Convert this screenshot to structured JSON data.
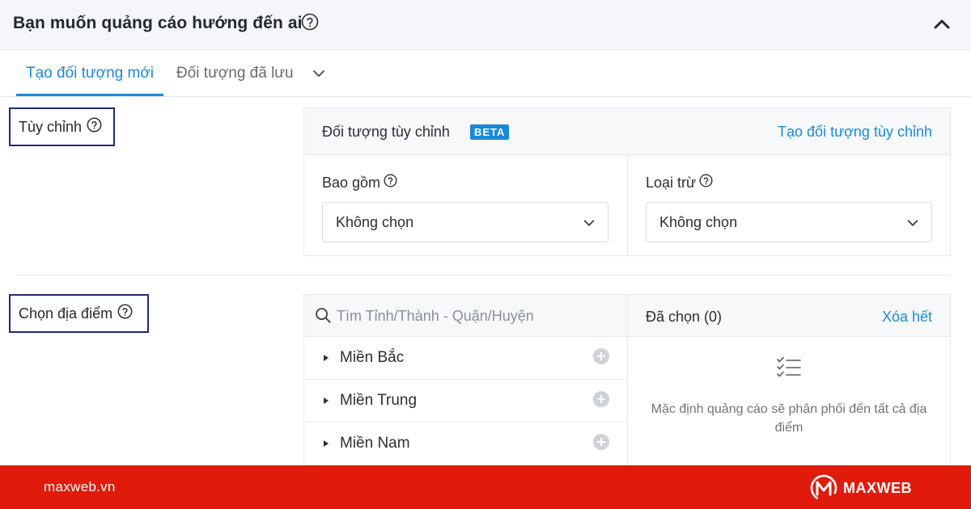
{
  "header": {
    "title": "Bạn muốn quảng cáo hướng đến ai",
    "help_icon": "question-circle-icon",
    "collapse_icon": "chevron-up-icon"
  },
  "tabs": [
    {
      "label": "Tạo đối tượng mới",
      "active": true
    },
    {
      "label": "Đối tượng đã lưu",
      "active": false
    }
  ],
  "custom_section": {
    "label": "Tùy chỉnh",
    "panel_title": "Đối tượng tùy chỉnh",
    "badge": "BETA",
    "create_link": "Tạo đối tượng tùy chỉnh",
    "include": {
      "label": "Bao gồm",
      "value": "Không chọn"
    },
    "exclude": {
      "label": "Loại trừ",
      "value": "Không chọn"
    }
  },
  "location_section": {
    "label": "Chọn địa điểm",
    "search_placeholder": "Tìm Tỉnh/Thành - Quận/Huyện",
    "regions": [
      {
        "name": "Miền Bắc"
      },
      {
        "name": "Miền Trung"
      },
      {
        "name": "Miền Nam"
      }
    ],
    "selected_title": "Đã chọn (0)",
    "clear_link": "Xóa hết",
    "empty_message": "Mặc định quảng cáo sẽ phân phối đến tất cả địa điểm"
  },
  "footer": {
    "site": "maxweb.vn",
    "brand": "MAXWEB"
  },
  "colors": {
    "accent": "#1a8ad8",
    "footer_bg": "#e01b0b",
    "highlight_border": "#1c2a7a"
  }
}
